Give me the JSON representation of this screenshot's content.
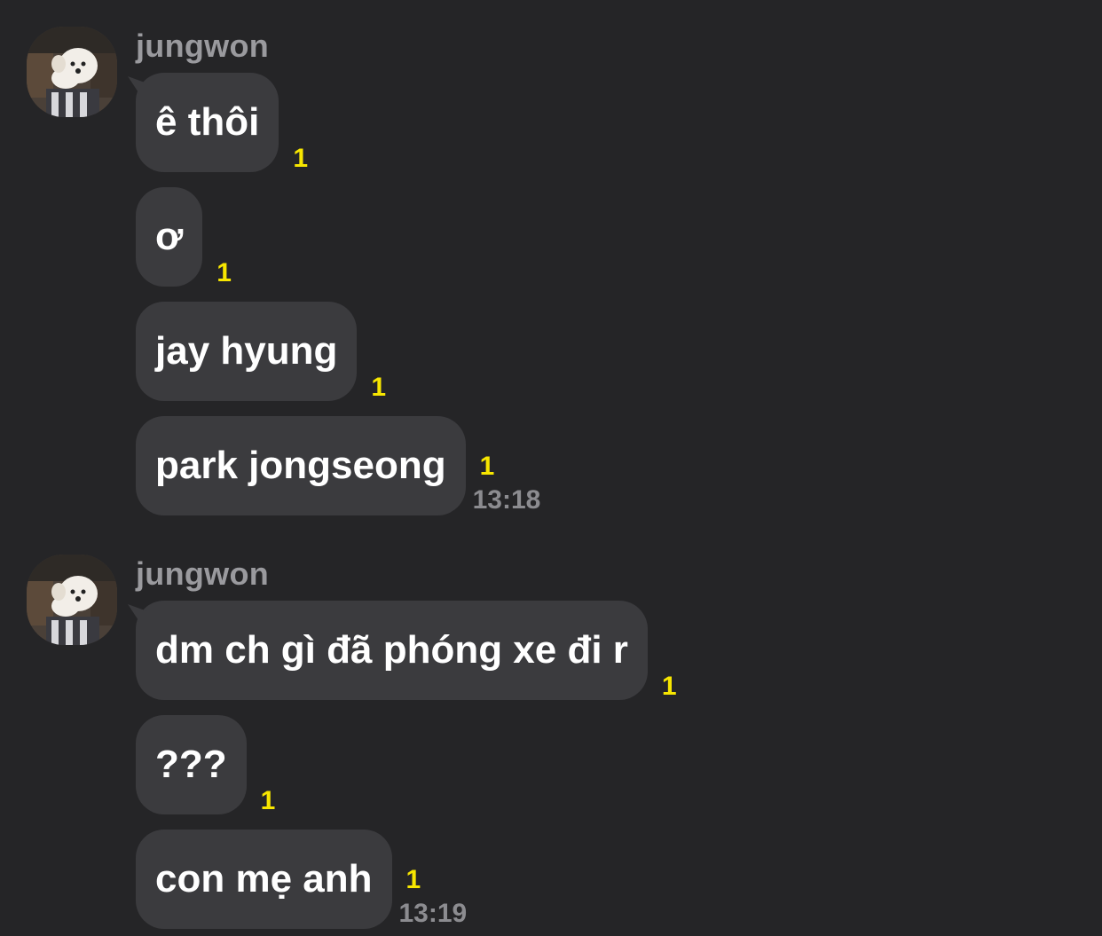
{
  "groups": [
    {
      "sender": "jungwon",
      "messages": [
        {
          "text": "ê thôi",
          "unread": "1"
        },
        {
          "text": "ơ",
          "unread": "1"
        },
        {
          "text": "jay hyung",
          "unread": "1"
        },
        {
          "text": "park jongseong",
          "unread": "1",
          "time": "13:18"
        }
      ]
    },
    {
      "sender": "jungwon",
      "messages": [
        {
          "text": "dm ch gì đã phóng xe đi r",
          "unread": "1"
        },
        {
          "text": "???",
          "unread": "1"
        },
        {
          "text": "con mẹ anh",
          "unread": "1",
          "time": "13:19"
        }
      ]
    }
  ],
  "colors": {
    "background": "#252527",
    "bubble": "#3b3b3e",
    "bubble_text": "#ffffff",
    "unread": "#f7e600",
    "sender": "#9a9a9e",
    "time": "#8c8c90"
  },
  "avatar_icon": "profile-photo-dog"
}
